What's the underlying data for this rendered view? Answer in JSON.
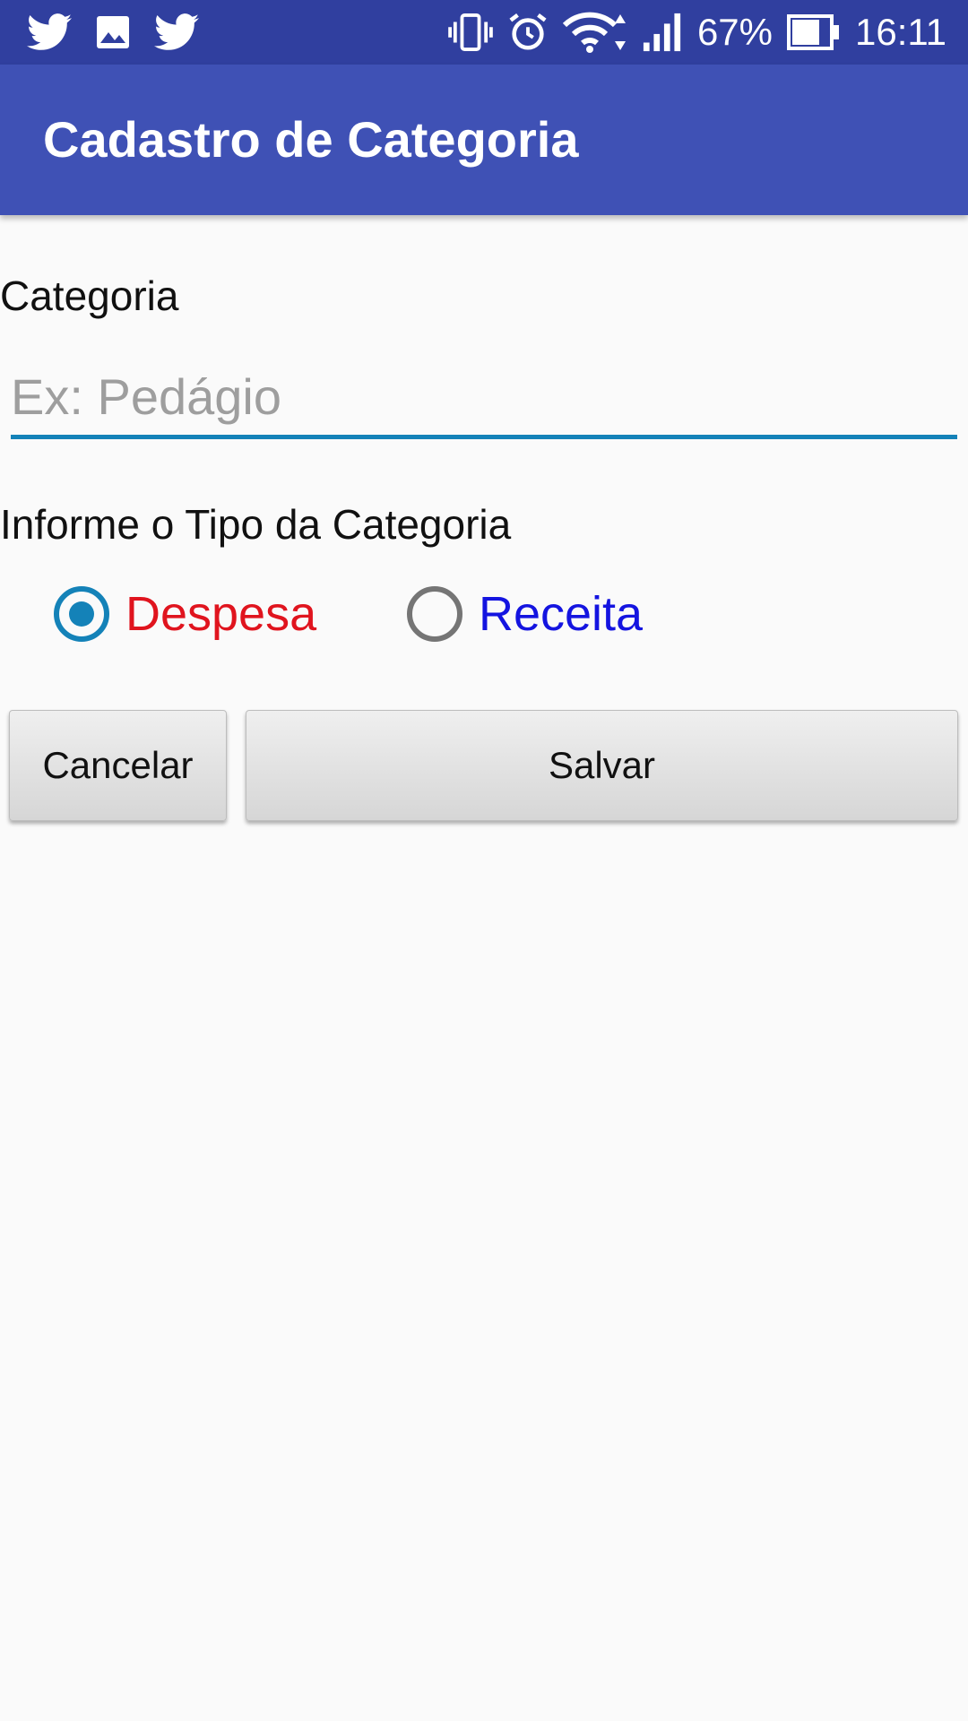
{
  "status_bar": {
    "left_icons": [
      "twitter-icon",
      "image-icon",
      "twitter-icon"
    ],
    "right_icons": [
      "vibrate-icon",
      "alarm-icon",
      "wifi-icon",
      "signal-icon",
      "battery-icon"
    ],
    "battery_percent": "67%",
    "time": "16:11",
    "background": "#303f9f"
  },
  "app_bar": {
    "title": "Cadastro de Categoria",
    "background": "#3f51b5"
  },
  "form": {
    "category_label": "Categoria",
    "category_input": {
      "value": "",
      "placeholder": "Ex: Pedágio"
    },
    "type_label": "Informe o Tipo da Categoria",
    "type_options": [
      {
        "label": "Despesa",
        "checked": true,
        "color": "#e0141e"
      },
      {
        "label": "Receita",
        "checked": false,
        "color": "#1414e0"
      }
    ],
    "accent_color": "#1482b8"
  },
  "buttons": {
    "cancel_label": "Cancelar",
    "save_label": "Salvar"
  }
}
